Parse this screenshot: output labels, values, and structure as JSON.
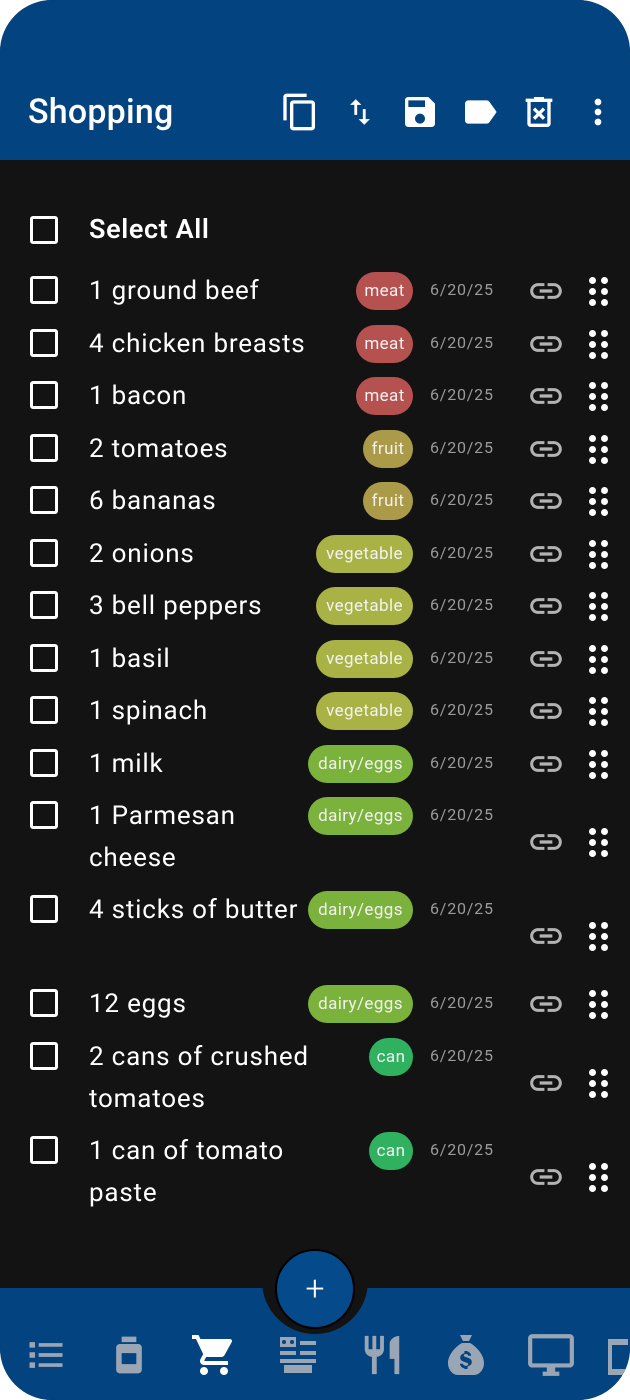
{
  "app_title": "Shopping",
  "toolbar": {
    "icons": [
      "copy-icon",
      "sort-icon",
      "save-icon",
      "label-icon",
      "delete-icon",
      "more-vert-icon"
    ]
  },
  "select_all_label": "Select All",
  "items": [
    {
      "name": "1 ground beef",
      "tag": "meat",
      "tag_color": "#b5524f",
      "date": "6/20/25"
    },
    {
      "name": "4 chicken breasts",
      "tag": "meat",
      "tag_color": "#b5524f",
      "date": "6/20/25"
    },
    {
      "name": "1 bacon",
      "tag": "meat",
      "tag_color": "#b5524f",
      "date": "6/20/25"
    },
    {
      "name": "2 tomatoes",
      "tag": "fruit",
      "tag_color": "#ab9a47",
      "date": "6/20/25"
    },
    {
      "name": "6 bananas",
      "tag": "fruit",
      "tag_color": "#ab9a47",
      "date": "6/20/25"
    },
    {
      "name": "2 onions",
      "tag": "vegetable",
      "tag_color": "#a9b244",
      "date": "6/20/25"
    },
    {
      "name": "3 bell peppers",
      "tag": "vegetable",
      "tag_color": "#a9b244",
      "date": "6/20/25"
    },
    {
      "name": "1 basil",
      "tag": "vegetable",
      "tag_color": "#a9b244",
      "date": "6/20/25"
    },
    {
      "name": "1 spinach",
      "tag": "vegetable",
      "tag_color": "#a9b244",
      "date": "6/20/25"
    },
    {
      "name": "1 milk",
      "tag": "dairy/eggs",
      "tag_color": "#7bb23c",
      "date": "6/20/25"
    },
    {
      "name": "1 Parmesan cheese",
      "tag": "dairy/eggs",
      "tag_color": "#7bb23c",
      "date": "6/20/25"
    },
    {
      "name": "4 sticks of butter",
      "tag": "dairy/eggs",
      "tag_color": "#7bb23c",
      "date": "6/20/25"
    },
    {
      "name": "12 eggs",
      "tag": "dairy/eggs",
      "tag_color": "#7bb23c",
      "date": "6/20/25"
    },
    {
      "name": "2 cans of crushed tomatoes",
      "tag": "can",
      "tag_color": "#2fb160",
      "date": "6/20/25"
    },
    {
      "name": "1 can of tomato paste",
      "tag": "can",
      "tag_color": "#2fb160",
      "date": "6/20/25"
    }
  ],
  "fab_label": "+",
  "bottom_nav": [
    "list-icon",
    "jar-icon",
    "cart-icon",
    "kitchen-icon",
    "utensils-icon",
    "money-bag-icon",
    "desktop-icon",
    "more-icon"
  ],
  "colors": {
    "primary": "#034480",
    "background": "#131313"
  }
}
